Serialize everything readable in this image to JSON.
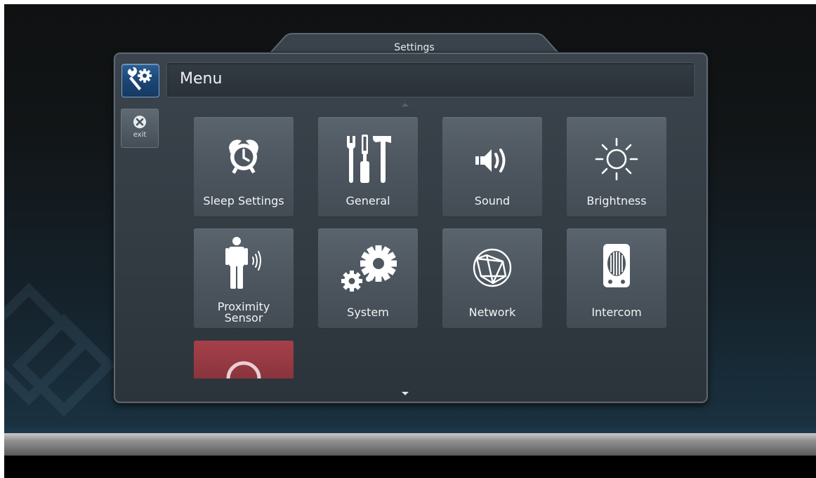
{
  "window": {
    "title": "Settings"
  },
  "header": {
    "title": "Menu",
    "icon": "wrench-gear-icon"
  },
  "sidebar": {
    "exit_label": "exit",
    "exit_icon": "close-icon"
  },
  "tiles": [
    {
      "label": "Sleep Settings",
      "icon": "alarm-clock-icon"
    },
    {
      "label": "General",
      "icon": "tools-icon"
    },
    {
      "label": "Sound",
      "icon": "speaker-icon"
    },
    {
      "label": "Brightness",
      "icon": "sun-icon"
    },
    {
      "label_line1": "Proximity",
      "label_line2": "Sensor",
      "icon": "person-proximity-icon"
    },
    {
      "label": "System",
      "icon": "gears-icon"
    },
    {
      "label": "Network",
      "icon": "globe-network-icon"
    },
    {
      "label": "Intercom",
      "icon": "intercom-speaker-icon"
    },
    {
      "label": "",
      "icon": "power-icon",
      "color": "#a6404a"
    }
  ],
  "colors": {
    "accent": "#1b4473",
    "panel": "#323a42",
    "tile": "#4d565f"
  }
}
